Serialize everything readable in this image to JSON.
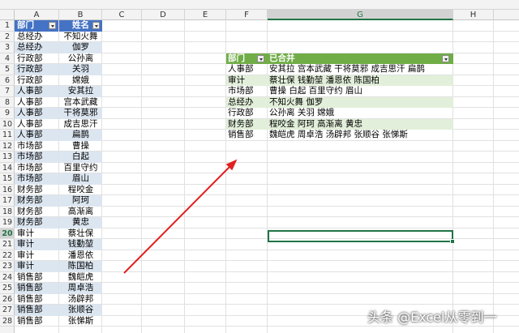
{
  "columns": [
    "A",
    "B",
    "C",
    "D",
    "E",
    "F",
    "G",
    "H"
  ],
  "selected_column": "G",
  "rows": [
    "1",
    "2",
    "3",
    "4",
    "5",
    "6",
    "7",
    "8",
    "9",
    "10",
    "11",
    "12",
    "13",
    "14",
    "15",
    "16",
    "17",
    "18",
    "19",
    "20",
    "21",
    "22",
    "23",
    "24",
    "25",
    "26",
    "27",
    "28"
  ],
  "selected_row": "20",
  "source_table": {
    "headers": [
      "部门",
      "姓名"
    ],
    "rows": [
      [
        "总经办",
        "不知火舞"
      ],
      [
        "总经办",
        "伽罗"
      ],
      [
        "行政部",
        "公孙离"
      ],
      [
        "行政部",
        "关羽"
      ],
      [
        "行政部",
        "嫦娥"
      ],
      [
        "人事部",
        "安其拉"
      ],
      [
        "人事部",
        "宫本武藏"
      ],
      [
        "人事部",
        "干将莫邪"
      ],
      [
        "人事部",
        "成吉思汗"
      ],
      [
        "人事部",
        "扁鹊"
      ],
      [
        "市场部",
        "曹操"
      ],
      [
        "市场部",
        "白起"
      ],
      [
        "市场部",
        "百里守约"
      ],
      [
        "市场部",
        "眉山"
      ],
      [
        "财务部",
        "程咬金"
      ],
      [
        "财务部",
        "阿珂"
      ],
      [
        "财务部",
        "高渐离"
      ],
      [
        "财务部",
        "黄忠"
      ],
      [
        "审计",
        "蔡壮保"
      ],
      [
        "审计",
        "钱勤堃"
      ],
      [
        "审计",
        "潘恩依"
      ],
      [
        "审计",
        "陈国柏"
      ],
      [
        "销售部",
        "魏皑虎"
      ],
      [
        "销售部",
        "周卓浩"
      ],
      [
        "销售部",
        "汤辟邦"
      ],
      [
        "销售部",
        "张顺谷"
      ],
      [
        "销售部",
        "张悌斯"
      ]
    ]
  },
  "result_table": {
    "headers": [
      "部门",
      "已合并"
    ],
    "rows": [
      [
        "人事部",
        "安其拉 宫本武藏 干将莫邪 成吉思汗 扁鹊"
      ],
      [
        "审计",
        "蔡壮保 钱勤堃 潘恩依 陈国柏"
      ],
      [
        "市场部",
        "曹操 白起 百里守约 眉山"
      ],
      [
        "总经办",
        "不知火舞 伽罗"
      ],
      [
        "行政部",
        "公孙离 关羽 嫦娥"
      ],
      [
        "财务部",
        "程咬金 阿珂 高渐离 黄忠"
      ],
      [
        "销售部",
        "魏皑虎 周卓浩 汤辟邦 张顺谷 张悌斯"
      ]
    ]
  },
  "watermark": "头条 @Excel从零到一",
  "colors": {
    "source_header": "#4472c4",
    "source_band": "#dce6f1",
    "result_header": "#70ad47",
    "result_band": "#e2efda",
    "selection": "#217346",
    "arrow": "#e02020"
  }
}
